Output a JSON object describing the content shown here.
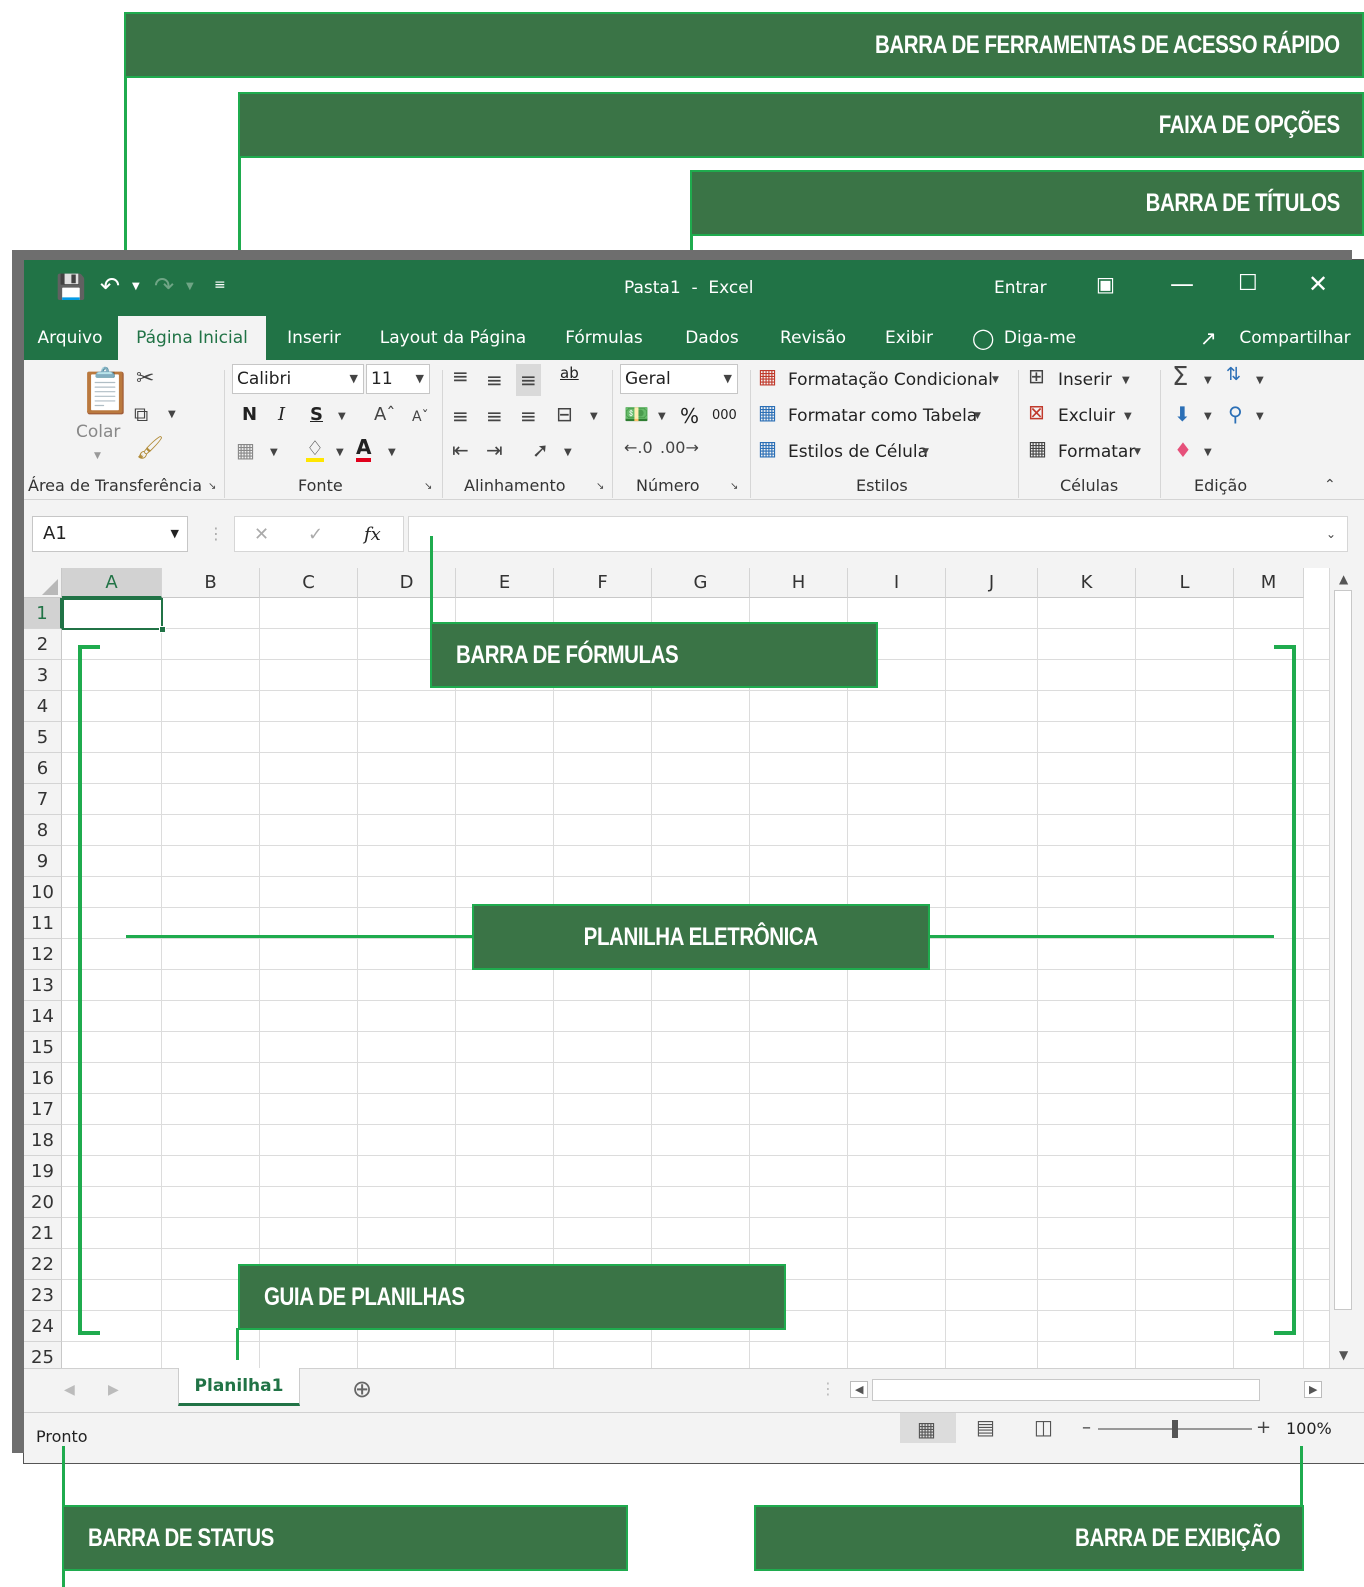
{
  "callouts": {
    "quick_access": "BARRA DE FERRAMENTAS DE ACESSO RÁPIDO",
    "ribbon": "FAIXA DE OPÇÕES",
    "title_bar": "BARRA DE TÍTULOS",
    "formula_bar": "BARRA DE FÓRMULAS",
    "worksheet": "PLANILHA ELETRÔNICA",
    "sheet_tabs": "GUIA DE PLANILHAS",
    "status_bar": "BARRA DE STATUS",
    "view_bar": "BARRA DE EXIBIÇÃO"
  },
  "window": {
    "title": "Pasta1  -  Excel",
    "signin": "Entrar"
  },
  "tabs": [
    "Arquivo",
    "Página Inicial",
    "Inserir",
    "Layout da Página",
    "Fórmulas",
    "Dados",
    "Revisão",
    "Exibir"
  ],
  "tell_me": "Diga-me",
  "share": "Compartilhar",
  "ribbon": {
    "paste": "Colar",
    "font_name": "Calibri",
    "font_size": "11",
    "number_format": "Geral",
    "conditional": "Formatação Condicional",
    "format_table": "Formatar como Tabela",
    "cell_styles": "Estilos de Célula",
    "insert": "Inserir",
    "delete": "Excluir",
    "format": "Formatar",
    "groups": [
      "Área de Transferência",
      "Fonte",
      "Alinhamento",
      "Número",
      "Estilos",
      "Células",
      "Edição"
    ],
    "bold": "N",
    "italic": "I",
    "underline": "S",
    "font_color_glyph": "A",
    "percent": "%",
    "thousands": "000",
    "wrap_text": "ab",
    "fx": "fx"
  },
  "name_box": "A1",
  "columns": [
    "A",
    "B",
    "C",
    "D",
    "E",
    "F",
    "G",
    "H",
    "I",
    "J",
    "K",
    "L",
    "M"
  ],
  "rows": [
    "1",
    "2",
    "3",
    "4",
    "5",
    "6",
    "7",
    "8",
    "9",
    "10",
    "11",
    "12",
    "13",
    "14",
    "15",
    "16",
    "17",
    "18",
    "19",
    "20",
    "21",
    "22",
    "23",
    "24",
    "25"
  ],
  "sheet_tab": "Planilha1",
  "status": {
    "ready": "Pronto",
    "zoom": "100%"
  },
  "accent_color": "#217346",
  "callout_color": "#3a7446"
}
